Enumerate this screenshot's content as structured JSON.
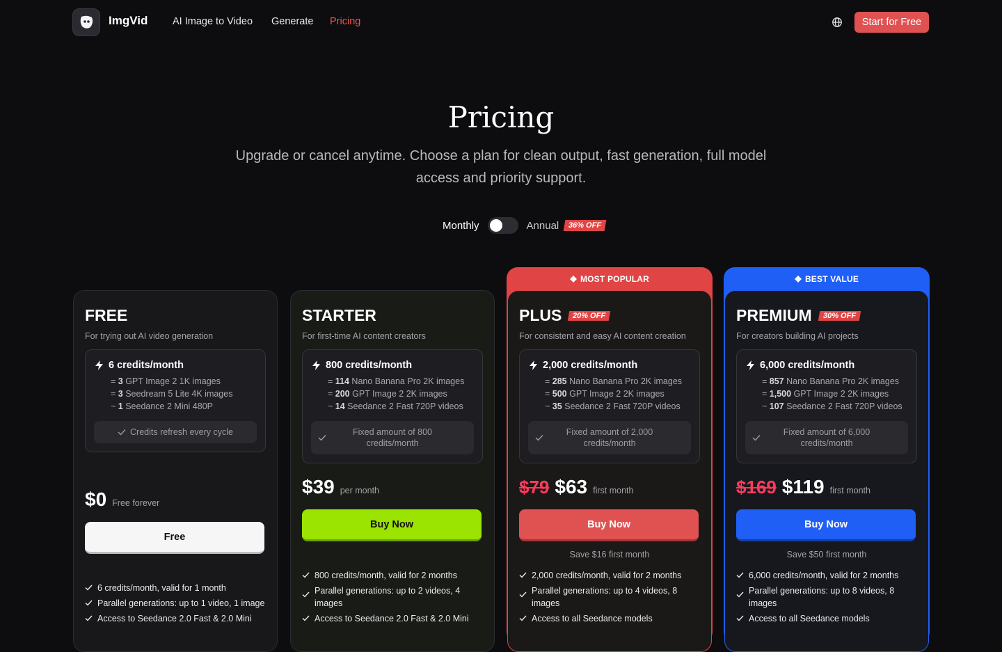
{
  "nav": {
    "brand": "ImgVid",
    "links": [
      "AI Image to Video",
      "Generate",
      "Pricing"
    ],
    "cta": "Start for Free"
  },
  "hero": {
    "title": "Pricing",
    "subtitle": "Upgrade or cancel anytime. Choose a plan for clean output, fast generation, full model access and priority support."
  },
  "billing": {
    "monthly": "Monthly",
    "annual": "Annual",
    "annual_badge": "36% OFF"
  },
  "plans": [
    {
      "name": "FREE",
      "badge": "",
      "ribbon": "",
      "description": "For trying out AI video generation",
      "credits": "6 credits/month",
      "breakdown": [
        {
          "prefix": "= ",
          "count": "3",
          "text": " GPT Image 2 1K images"
        },
        {
          "prefix": "= ",
          "count": "3",
          "text": " Seedream 5 Lite 4K images"
        },
        {
          "prefix": "~ ",
          "count": "1",
          "text": " Seedance 2 Mini 480P"
        }
      ],
      "note": "Credits refresh every cycle",
      "old_price": "",
      "price": "$0",
      "price_note": "Free forever",
      "button": "Free",
      "save": "",
      "features": [
        "6 credits/month, valid for 1 month",
        "Parallel generations: up to 1 video, 1 image",
        "Access to Seedance 2.0 Fast & 2.0 Mini"
      ]
    },
    {
      "name": "STARTER",
      "badge": "",
      "ribbon": "",
      "description": "For first-time AI content creators",
      "credits": "800 credits/month",
      "breakdown": [
        {
          "prefix": "= ",
          "count": "114",
          "text": " Nano Banana Pro 2K images"
        },
        {
          "prefix": "= ",
          "count": "200",
          "text": " GPT Image 2 2K images"
        },
        {
          "prefix": "~ ",
          "count": "14",
          "text": " Seedance 2 Fast 720P videos"
        }
      ],
      "note": "Fixed amount of 800 credits/month",
      "old_price": "",
      "price": "$39",
      "price_note": "per month",
      "button": "Buy Now",
      "save": "",
      "features": [
        "800 credits/month, valid for 2 months",
        "Parallel generations: up to 2 videos, 4 images",
        "Access to Seedance 2.0 Fast & 2.0 Mini"
      ]
    },
    {
      "name": "PLUS",
      "badge": "20% OFF",
      "ribbon": "MOST POPULAR",
      "description": "For consistent and easy AI content creation",
      "credits": "2,000 credits/month",
      "breakdown": [
        {
          "prefix": "= ",
          "count": "285",
          "text": " Nano Banana Pro 2K images"
        },
        {
          "prefix": "= ",
          "count": "500",
          "text": " GPT Image 2 2K images"
        },
        {
          "prefix": "~ ",
          "count": "35",
          "text": " Seedance 2 Fast 720P videos"
        }
      ],
      "note": "Fixed amount of 2,000 credits/month",
      "old_price": "$79",
      "price": "$63",
      "price_note": "first month",
      "button": "Buy Now",
      "save": "Save $16 first month",
      "features": [
        "2,000 credits/month, valid for 2 months",
        "Parallel generations: up to 4 videos, 8 images",
        "Access to all Seedance models"
      ]
    },
    {
      "name": "PREMIUM",
      "badge": "30% OFF",
      "ribbon": "BEST VALUE",
      "description": "For creators building AI projects",
      "credits": "6,000 credits/month",
      "breakdown": [
        {
          "prefix": "= ",
          "count": "857",
          "text": " Nano Banana Pro 2K images"
        },
        {
          "prefix": "= ",
          "count": "1,500",
          "text": " GPT Image 2 2K images"
        },
        {
          "prefix": "~ ",
          "count": "107",
          "text": " Seedance 2 Fast 720P videos"
        }
      ],
      "note": "Fixed amount of 6,000 credits/month",
      "old_price": "$169",
      "price": "$119",
      "price_note": "first month",
      "button": "Buy Now",
      "save": "Save $50 first month",
      "features": [
        "6,000 credits/month, valid for 2 months",
        "Parallel generations: up to 8 videos, 8 images",
        "Access to all Seedance models"
      ]
    }
  ],
  "colors": {
    "accent_red": "#e05252",
    "starter_green": "#9be300",
    "premium_blue": "#1f5ff5",
    "strike_pink": "#ff3b5c"
  }
}
